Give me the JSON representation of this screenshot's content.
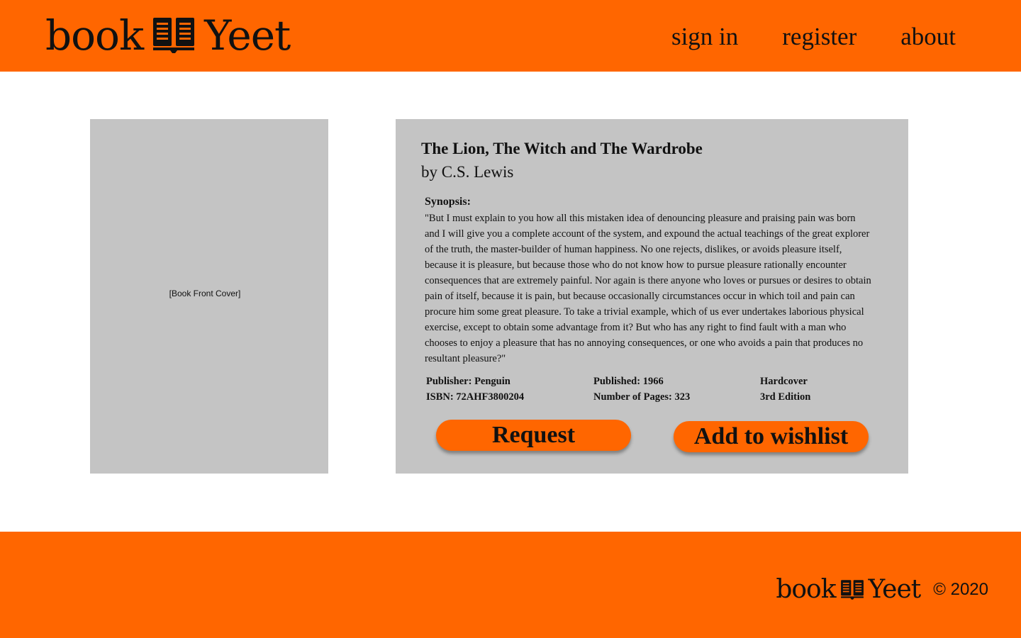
{
  "header": {
    "logo_left": "book",
    "logo_right": "Yeet",
    "logo_icon": "open-book-icon",
    "nav": [
      {
        "label": "sign in"
      },
      {
        "label": "register"
      },
      {
        "label": "about"
      }
    ]
  },
  "cover": {
    "label": "[Book Front Cover]"
  },
  "book": {
    "title": "The Lion, The Witch and The Wardrobe",
    "author": "by C.S. Lewis",
    "synopsis_heading": "Synopsis:",
    "synopsis": "\"But I must explain to you how all this mistaken idea of denouncing pleasure and praising pain was born and I will give you a complete account of the system, and expound the actual teachings of the great explorer of the truth, the master-builder of human happiness. No one rejects, dislikes, or avoids pleasure itself, because it is pleasure, but because those who do not know how to pursue pleasure rationally encounter consequences that are extremely painful. Nor again is there anyone who loves or pursues or desires to obtain pain of itself, because it is pain, but because occasionally circumstances occur in which toil and pain can procure him some great pleasure. To take a trivial example, which of us ever undertakes laborious physical exercise, except to obtain some advantage from it? But who has any right to find fault with a man who chooses to enjoy a pleasure that has no annoying consequences, or one who avoids a pain that produces no resultant pleasure?\"",
    "publisher": "Publisher: Penguin",
    "isbn": "ISBN: 72AHF3800204",
    "published": "Published: 1966",
    "pages": "Number of Pages: 323",
    "format": "Hardcover",
    "edition": "3rd Edition"
  },
  "actions": {
    "request_label": "Request",
    "wishlist_label": "Add to wishlist"
  },
  "footer": {
    "logo_left": "book",
    "logo_right": "Yeet",
    "logo_icon": "open-book-icon",
    "copyright": "© 2020"
  },
  "colors": {
    "brand_orange": "#ff6600",
    "panel_gray": "#c4c4c4",
    "text": "#111111"
  }
}
